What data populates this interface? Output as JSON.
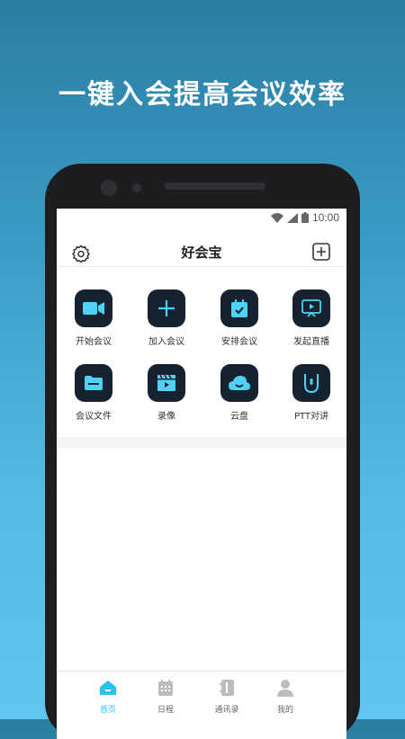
{
  "headline": "一键入会提高会议效率",
  "status_bar": {
    "time": "10:00"
  },
  "app": {
    "title": "好会宝"
  },
  "features": [
    {
      "label": "开始会议",
      "icon": "video-camera-icon"
    },
    {
      "label": "加入会议",
      "icon": "plus-icon"
    },
    {
      "label": "安排会议",
      "icon": "calendar-check-icon"
    },
    {
      "label": "发起直播",
      "icon": "live-stream-icon"
    },
    {
      "label": "会议文件",
      "icon": "folder-icon"
    },
    {
      "label": "录像",
      "icon": "film-icon"
    },
    {
      "label": "云盘",
      "icon": "cloud-icon"
    },
    {
      "label": "PTT对讲",
      "icon": "walkie-talkie-icon"
    }
  ],
  "tabs": [
    {
      "label": "首页",
      "icon": "home-icon",
      "active": true
    },
    {
      "label": "日程",
      "icon": "calendar-icon",
      "active": false
    },
    {
      "label": "通讯录",
      "icon": "contacts-icon",
      "active": false
    },
    {
      "label": "我的",
      "icon": "person-icon",
      "active": false
    }
  ],
  "colors": {
    "accent": "#2bc3ee",
    "tile_bg": "#172230",
    "active_tab": "#2bc3ee"
  }
}
